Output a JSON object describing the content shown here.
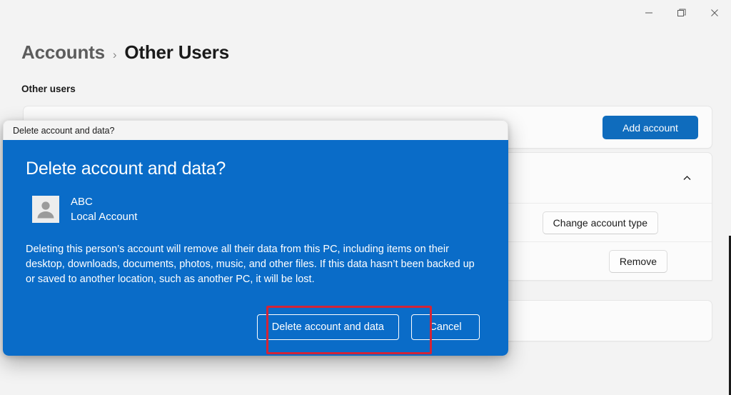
{
  "window": {
    "controls": [
      {
        "name": "minimize",
        "glyph": "minimize-icon"
      },
      {
        "name": "maximize",
        "glyph": "maximize-icon"
      },
      {
        "name": "close",
        "glyph": "close-icon"
      }
    ]
  },
  "breadcrumb": {
    "parent": "Accounts",
    "separator": "›",
    "current": "Other Users"
  },
  "page": {
    "section_label": "Other users",
    "add_account_button": "Add account",
    "expander_icon": "chevron-up-icon",
    "change_account_type_button": "Change account type",
    "remove_button": "Remove"
  },
  "dialog": {
    "titlebar_title": "Delete account and data?",
    "heading": "Delete account and data?",
    "avatar_icon": "user-avatar-icon",
    "account_name": "ABC",
    "account_type": "Local Account",
    "body_text": "Deleting this person’s account will remove all their data from this PC, including items on their desktop, downloads, documents, photos, music, and other files. If this data hasn’t been backed up or saved to another location, such as another PC, it will be lost.",
    "confirm_button": "Delete account and data",
    "cancel_button": "Cancel"
  },
  "colors": {
    "dialog_blue": "#0a6cc8",
    "accent_blue": "#0f6cbd",
    "highlight_red": "#d32436",
    "page_background": "#f3f3f3",
    "card_background": "#fbfbfb"
  }
}
